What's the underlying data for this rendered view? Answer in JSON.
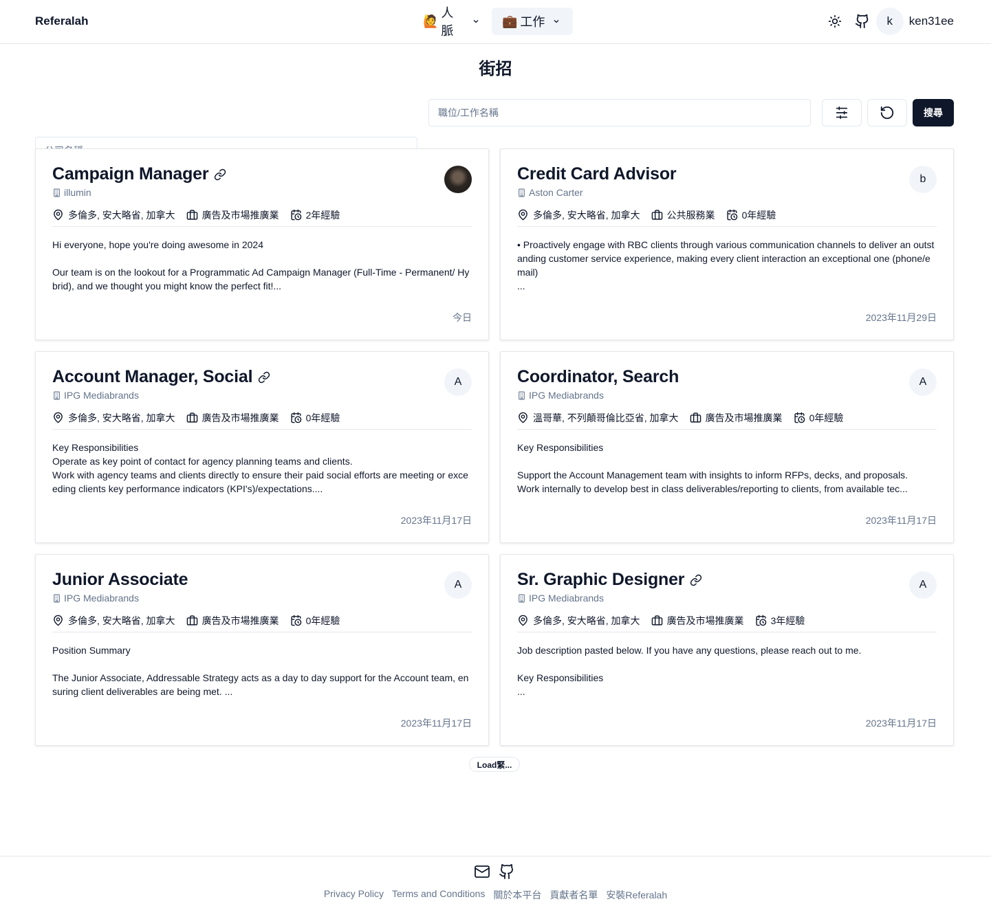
{
  "header": {
    "brand": "Referalah",
    "nav": [
      {
        "emoji": "🙋",
        "label": "人脈"
      },
      {
        "emoji": "💼",
        "label": "工作"
      }
    ],
    "user": {
      "initial": "k",
      "name": "ken31ee"
    }
  },
  "page": {
    "title": "街招"
  },
  "search": {
    "company_placeholder": "公司名稱",
    "position_placeholder": "職位/工作名稱",
    "search_label": "搜尋"
  },
  "cards": [
    {
      "title": "Campaign Manager",
      "has_link": true,
      "company": "illumin",
      "avatar": "",
      "avatar_photo": true,
      "location": "多倫多, 安大略省, 加拿大",
      "industry": "廣告及市場推廣業",
      "experience": "2年經驗",
      "description": "Hi everyone, hope you're doing awesome in 2024\n\nOur team is on the lookout for a Programmatic Ad Campaign Manager (Full-Time - Permanent/ Hybrid), and we thought you might know the perfect fit!...",
      "date": "今日"
    },
    {
      "title": "Credit Card Advisor",
      "has_link": false,
      "company": "Aston Carter",
      "avatar": "b",
      "location": "多倫多, 安大略省, 加拿大",
      "industry": "公共服務業",
      "experience": "0年經驗",
      "description": "• Proactively engage with RBC clients through various communication channels to deliver an outstanding customer service experience, making every client interaction an exceptional one (phone/email)\n...",
      "date": "2023年11月29日"
    },
    {
      "title": "Account Manager, Social",
      "has_link": true,
      "company": "IPG Mediabrands",
      "avatar": "A",
      "location": "多倫多, 安大略省, 加拿大",
      "industry": "廣告及市場推廣業",
      "experience": "0年經驗",
      "description": "Key Responsibilities\nOperate as key point of contact for agency planning teams and clients.\nWork with agency teams and clients directly to ensure their paid social efforts are meeting or exceeding clients key performance indicators (KPI's)/expectations....",
      "date": "2023年11月17日"
    },
    {
      "title": "Coordinator, Search",
      "has_link": false,
      "company": "IPG Mediabrands",
      "avatar": "A",
      "location": "溫哥華, 不列顛哥倫比亞省, 加拿大",
      "industry": "廣告及市場推廣業",
      "experience": "0年經驗",
      "description": "Key Responsibilities\n\nSupport the Account Management team with insights to inform RFPs, decks, and proposals.\nWork internally to develop best in class deliverables/reporting to clients, from available tec...",
      "date": "2023年11月17日"
    },
    {
      "title": "Junior Associate",
      "has_link": false,
      "company": "IPG Mediabrands",
      "avatar": "A",
      "location": "多倫多, 安大略省, 加拿大",
      "industry": "廣告及市場推廣業",
      "experience": "0年經驗",
      "description": "Position Summary\n\nThe Junior Associate, Addressable Strategy acts as a day to day support for the Account team, ensuring client deliverables are being met. ...",
      "date": "2023年11月17日"
    },
    {
      "title": "Sr. Graphic Designer",
      "has_link": true,
      "company": "IPG Mediabrands",
      "avatar": "A",
      "location": "多倫多, 安大略省, 加拿大",
      "industry": "廣告及市場推廣業",
      "experience": "3年經驗",
      "description": "Job description pasted below. If you have any questions, please reach out to me.\n\nKey Responsibilities\n...",
      "date": "2023年11月17日"
    }
  ],
  "load_more": "Load緊...",
  "footer": {
    "links": [
      "Privacy Policy",
      "Terms and Conditions",
      "關於本平台",
      "貢獻者名單",
      "安裝Referalah"
    ]
  }
}
